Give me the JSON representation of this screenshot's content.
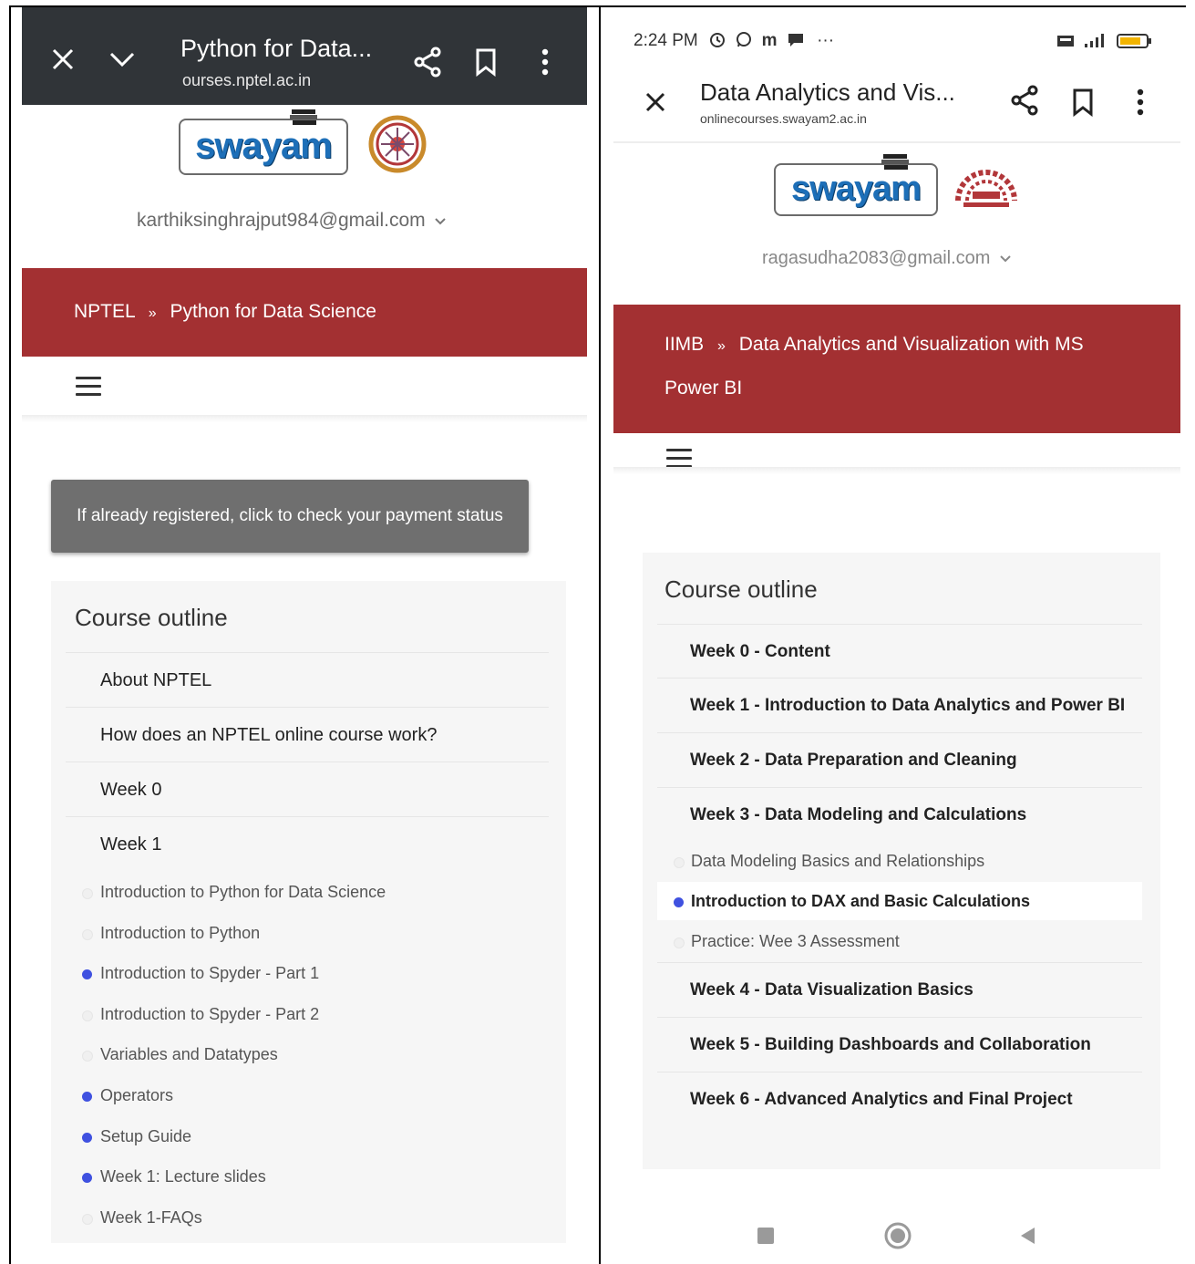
{
  "left_phone": {
    "browser": {
      "title": "Python for Data...",
      "url": "ourses.nptel.ac.in"
    },
    "logo": {
      "name": "swayam"
    },
    "user": {
      "email": "karthiksinghrajput984@gmail.com"
    },
    "breadcrumb": {
      "root": "NPTEL",
      "separator": "»",
      "course": "Python for Data Science"
    },
    "payment_button": "If already registered, click to check your payment status",
    "outline": {
      "title": "Course outline",
      "sections": [
        {
          "label": "About NPTEL"
        },
        {
          "label": "How does an NPTEL online course work?"
        },
        {
          "label": "Week 0"
        },
        {
          "label": "Week 1"
        }
      ],
      "units": [
        {
          "label": "Introduction to Python for Data Science",
          "done": false
        },
        {
          "label": "Introduction to Python",
          "done": false
        },
        {
          "label": "Introduction to Spyder - Part 1",
          "done": true
        },
        {
          "label": "Introduction to Spyder - Part 2",
          "done": false
        },
        {
          "label": "Variables and Datatypes",
          "done": false
        },
        {
          "label": "Operators",
          "done": true
        },
        {
          "label": "Setup Guide",
          "done": true
        },
        {
          "label": "Week 1: Lecture slides",
          "done": true
        },
        {
          "label": "Week 1-FAQs",
          "done": false
        }
      ]
    }
  },
  "right_phone": {
    "status_bar": {
      "time": "2:24 PM",
      "icons_text": "m",
      "more": "···"
    },
    "browser": {
      "title": "Data Analytics and Vis...",
      "url": "onlinecourses.swayam2.ac.in"
    },
    "logo": {
      "name": "swayam"
    },
    "user": {
      "email": "ragasudha2083@gmail.com"
    },
    "breadcrumb": {
      "root": "IIMB",
      "separator": "»",
      "course_line1": "Data Analytics and Visualization with MS",
      "course_line2": "Power BI"
    },
    "outline": {
      "title": "Course outline",
      "sections_before": [
        {
          "label": "Week 0 - Content"
        },
        {
          "label": "Week 1 - Introduction to Data Analytics and Power BI"
        },
        {
          "label": "Week 2 - Data Preparation and Cleaning"
        },
        {
          "label": "Week 3 - Data Modeling and Calculations"
        }
      ],
      "units": [
        {
          "label": "Data Modeling Basics and Relationships",
          "done": false
        },
        {
          "label": "Introduction to DAX and Basic Calculations",
          "done": true
        },
        {
          "label": "Practice: Wee 3 Assessment",
          "done": false
        }
      ],
      "sections_after": [
        {
          "label": "Week 4 - Data Visualization Basics"
        },
        {
          "label": "Week 5 - Building Dashboards and Collaboration"
        },
        {
          "label": "Week 6 - Advanced Analytics and Final Project"
        }
      ]
    }
  },
  "colors": {
    "banner": "#a33032",
    "browser_bar_dark": "#303438",
    "progress_dot": "#3f51e0",
    "payment_button": "#6f6f6f"
  }
}
